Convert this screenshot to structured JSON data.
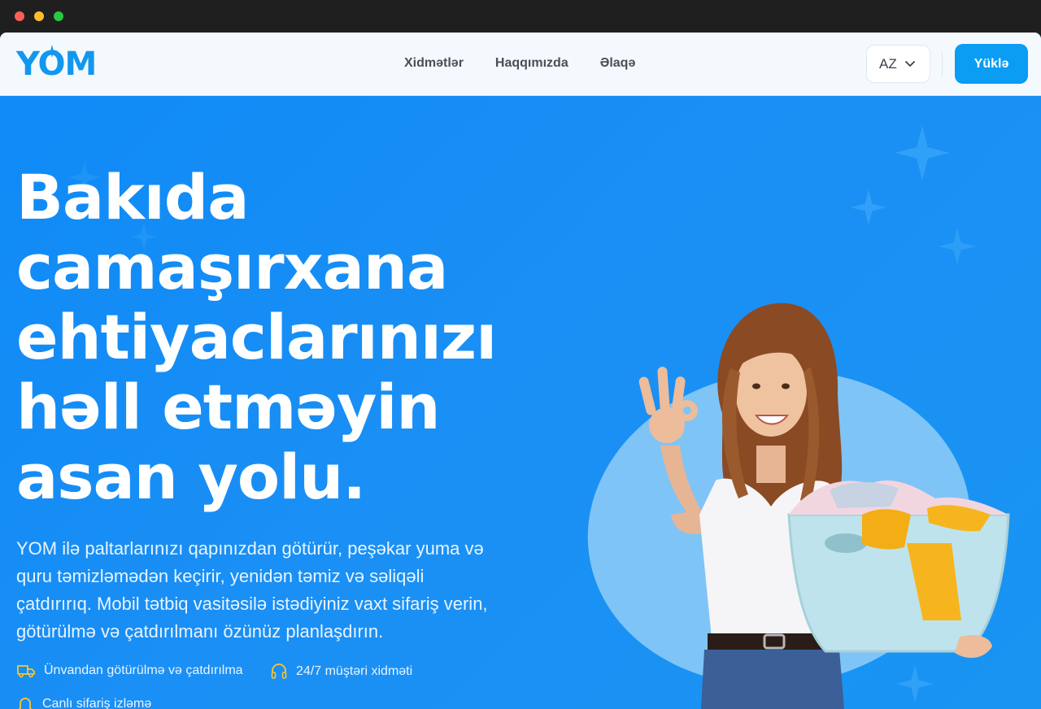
{
  "window": {
    "controls": [
      "close",
      "minimize",
      "maximize"
    ]
  },
  "brand": {
    "logo_text": "YOM"
  },
  "nav": {
    "links": [
      "Xidmətlər",
      "Haqqımızda",
      "Əlaqə"
    ],
    "language": "AZ",
    "download_label": "Yüklə"
  },
  "hero": {
    "title": "Bakıda camaşırxana ehtiyaclarınızı həll etməyin asan yolu.",
    "description": "YOM ilə paltarlarınızı qapınızdan götürür, peşəkar yuma və quru təmizləmədən keçirir, yenidən təmiz və səliqəli çatdırırıq. Mobil tətbiq vasitəsilə istədiyiniz vaxt sifariş verin, götürülmə və çatdırılmanı özünüz planlaşdırın.",
    "features": [
      {
        "icon": "truck-icon",
        "label": "Ünvandan götürülmə və çatdırılma"
      },
      {
        "icon": "headset-icon",
        "label": "24/7 müştəri xidməti"
      },
      {
        "icon": "bell-icon",
        "label": "Canlı sifariş izləmə"
      }
    ]
  },
  "colors": {
    "brand": "#1297ef",
    "hero_bg": "#1a8ff5",
    "button": "#0b9cf3",
    "accent_icon": "#ffc629"
  }
}
